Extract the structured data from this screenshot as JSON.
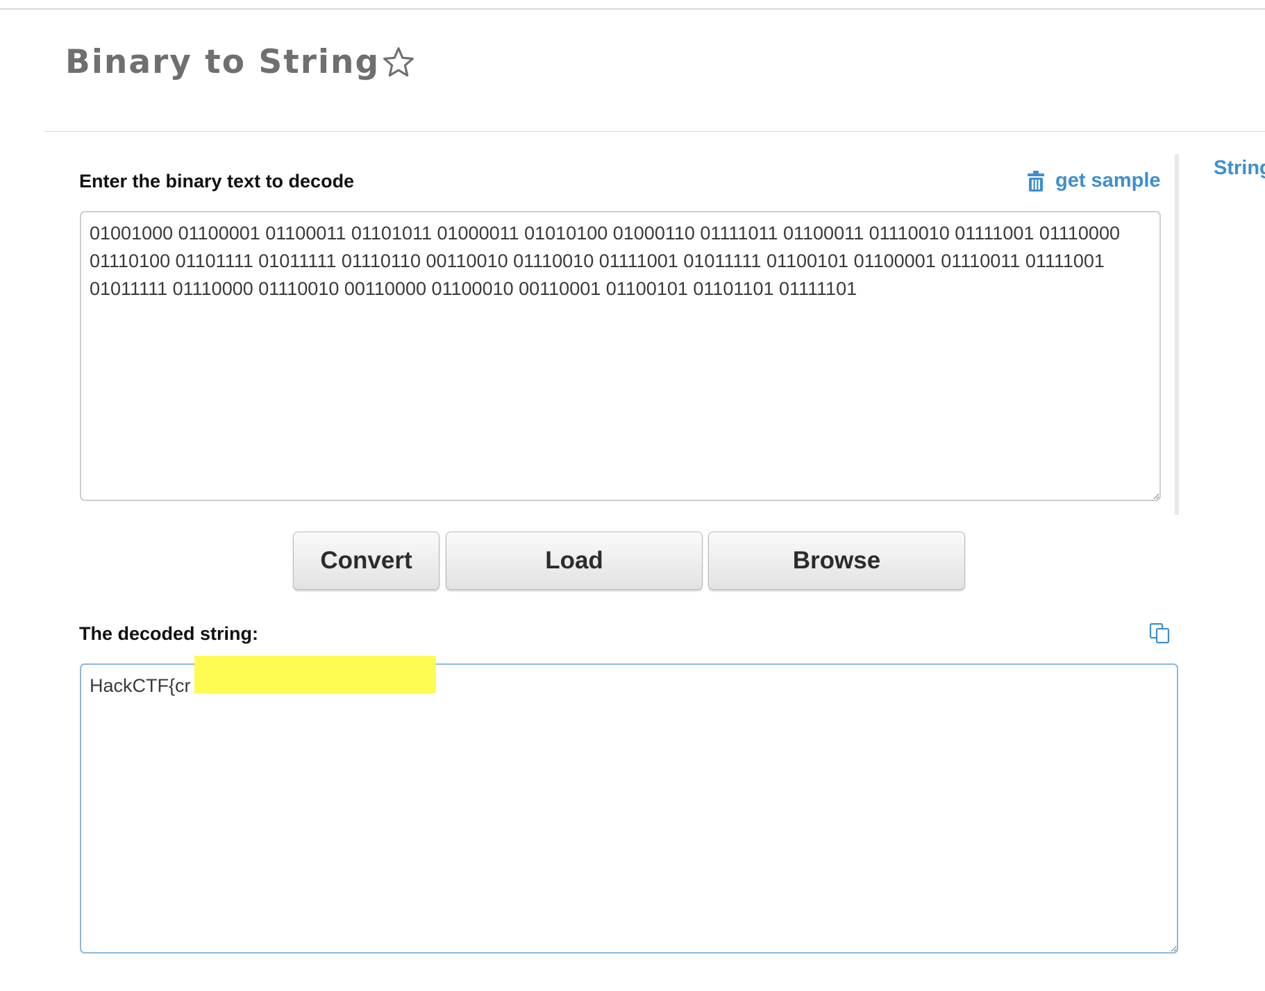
{
  "page": {
    "title": "Binary to String"
  },
  "sidebar": {
    "link_label": "String"
  },
  "input": {
    "label": "Enter the binary text to decode",
    "sample_link": "get sample",
    "value": "01001000 01100001 01100011 01101011 01000011 01010100 01000110 01111011 01100011 01110010 01111001 01110000 01110100 01101111 01011111 01110110 00110010 01110010 01111001 01011111 01100101 01100001 01110011 01111001 01011111 01110000 01110010 00110000 01100010 00110001 01100101 01101101 01111101"
  },
  "actions": {
    "convert_label": "Convert",
    "load_label": "Load",
    "browse_label": "Browse"
  },
  "output": {
    "label": "The decoded string:",
    "value": "HackCTF{cr"
  },
  "icons": {
    "title_star": "star-outline-icon",
    "sample": "trash-icon",
    "copy": "copy-icon"
  },
  "colors": {
    "link": "#3d8fd0",
    "title": "#6f6f6f",
    "output_border": "#8ab7df",
    "redaction": "#fefb52"
  }
}
